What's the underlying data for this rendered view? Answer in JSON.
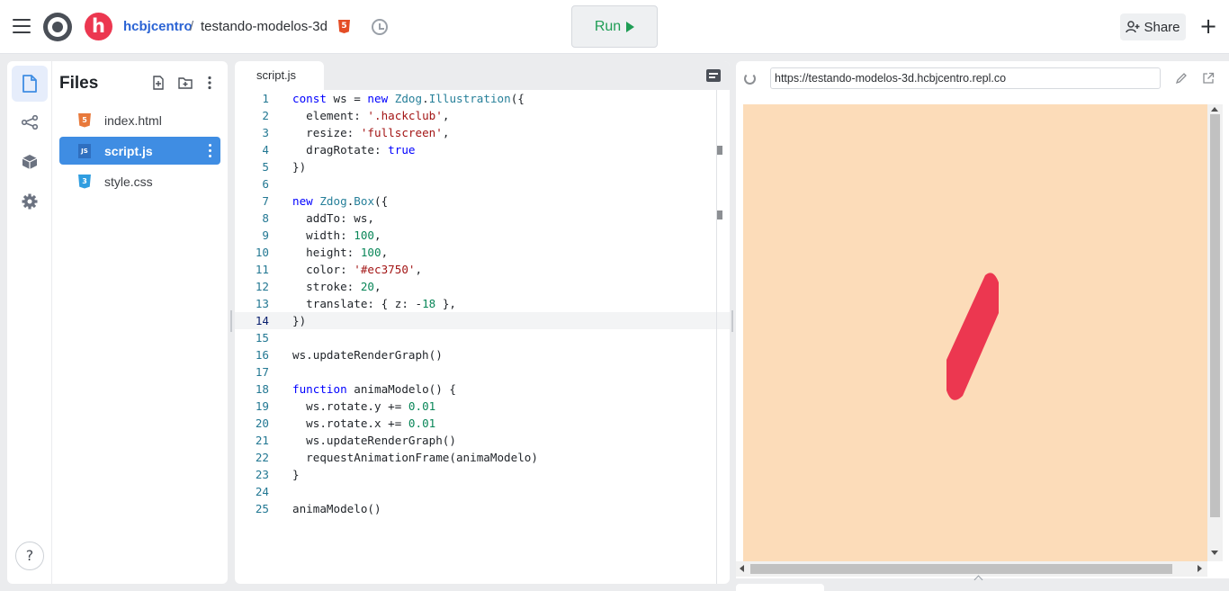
{
  "topbar": {
    "owner": "hcbjcentro",
    "separator": "/",
    "repl_name": "testando-modelos-3d",
    "avatar_letter": "h",
    "language_badge": "5",
    "run_label": "Run",
    "share_label": "Share",
    "plus_label": "+"
  },
  "rail": {
    "items": [
      "files-icon",
      "git-icon",
      "packages-icon",
      "settings-icon"
    ],
    "help_label": "?"
  },
  "files": {
    "title": "Files",
    "items": [
      {
        "name": "index.html",
        "icon": "html5-icon",
        "color": "#e8793b"
      },
      {
        "name": "script.js",
        "icon": "js-icon",
        "color": "#3f8de3",
        "active": true
      },
      {
        "name": "style.css",
        "icon": "css3-icon",
        "color": "#2f9de0"
      }
    ]
  },
  "editor": {
    "tab": "script.js",
    "current_line": 14,
    "lines": [
      "const ws = new Zdog.Illustration({",
      "  element: '.hackclub',",
      "  resize: 'fullscreen',",
      "  dragRotate: true",
      "})",
      "",
      "new Zdog.Box({",
      "  addTo: ws,",
      "  width: 100,",
      "  height: 100,",
      "  color: '#ec3750',",
      "  stroke: 20,",
      "  translate: { z: -18 },",
      "})",
      "",
      "ws.updateRenderGraph()",
      "",
      "function animaModelo() {",
      "  ws.rotate.y += 0.01",
      "  ws.rotate.x += 0.01",
      "  ws.updateRenderGraph()",
      "  requestAnimationFrame(animaModelo)",
      "}",
      "",
      "animaModelo()"
    ]
  },
  "webview": {
    "url": "https://testando-modelos-3d.hcbjcentro.repl.co",
    "background": "#fcdcb9",
    "shape_color": "#ec3750"
  },
  "colors": {
    "accent": "#3f8de3",
    "run_green": "#1f9d55",
    "brand_red": "#ec3750"
  }
}
